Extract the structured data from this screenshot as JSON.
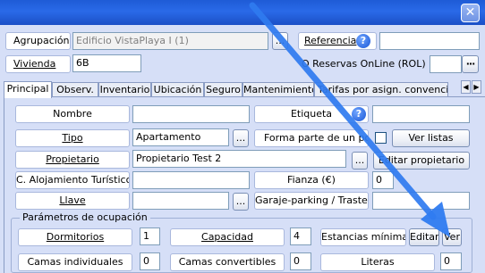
{
  "window": {
    "close_glyph": "✕"
  },
  "header": {
    "agrupacion_label": "Agrupación",
    "agrupacion_value": "Edificio VistaPlaya I (1)",
    "agrupacion_browse": "...",
    "referencia_label": "Referencia",
    "referencia_value": "",
    "vivienda_label": "Vivienda",
    "vivienda_value": "6B",
    "reservas_label": "O Reservas OnLine (ROL)",
    "reservas_value": "",
    "reservas_dots": "···"
  },
  "tabs": [
    {
      "label": "Principal",
      "active": true
    },
    {
      "label": "Observ."
    },
    {
      "label": "Inventario"
    },
    {
      "label": "Ubicación"
    },
    {
      "label": "Seguro"
    },
    {
      "label": "Mantenimiento"
    },
    {
      "label": "Tarifas por asign. convencion"
    }
  ],
  "tab_scroll": {
    "left": "◀",
    "right": "▶"
  },
  "form": {
    "nombre_label": "Nombre",
    "nombre_value": "",
    "etiqueta_label": "Etiqueta",
    "etiqueta_value": "",
    "tipo_label": "Tipo",
    "tipo_value": "Apartamento",
    "tipo_browse": "...",
    "forma_parte_label": "Forma parte de un pool",
    "ver_listas_button": "Ver listas",
    "propietario_label": "Propietario",
    "propietario_value": "Propietario Test 2",
    "propietario_browse": "...",
    "editar_propietario_button": "Editar propietario",
    "alojamiento_label": "C. Alojamiento Turístico",
    "alojamiento_value": "",
    "fianza_label": "Fianza (€)",
    "fianza_value": "0",
    "llave_label": "Llave",
    "llave_value": "",
    "llave_browse": "...",
    "garaje_label": "Garaje-parking / Trastero",
    "garaje_value": ""
  },
  "ocupacion": {
    "title": "Parámetros de ocupación",
    "dormitorios_label": "Dormitorios",
    "dormitorios_value": "1",
    "capacidad_label": "Capacidad",
    "capacidad_value": "4",
    "estancias_label": "Estancias mínimas",
    "editar_button": "Editar",
    "ver_button": "Ver",
    "camas_ind_label": "Camas individuales",
    "camas_ind_value": "0",
    "camas_conv_label": "Camas convertibles",
    "camas_conv_value": "0",
    "literas_label": "Literas",
    "literas_value": "0"
  },
  "colors": {
    "arrow": "#2f7bf0",
    "titlebar": "#1e5bd6",
    "background": "#d6dff7"
  }
}
